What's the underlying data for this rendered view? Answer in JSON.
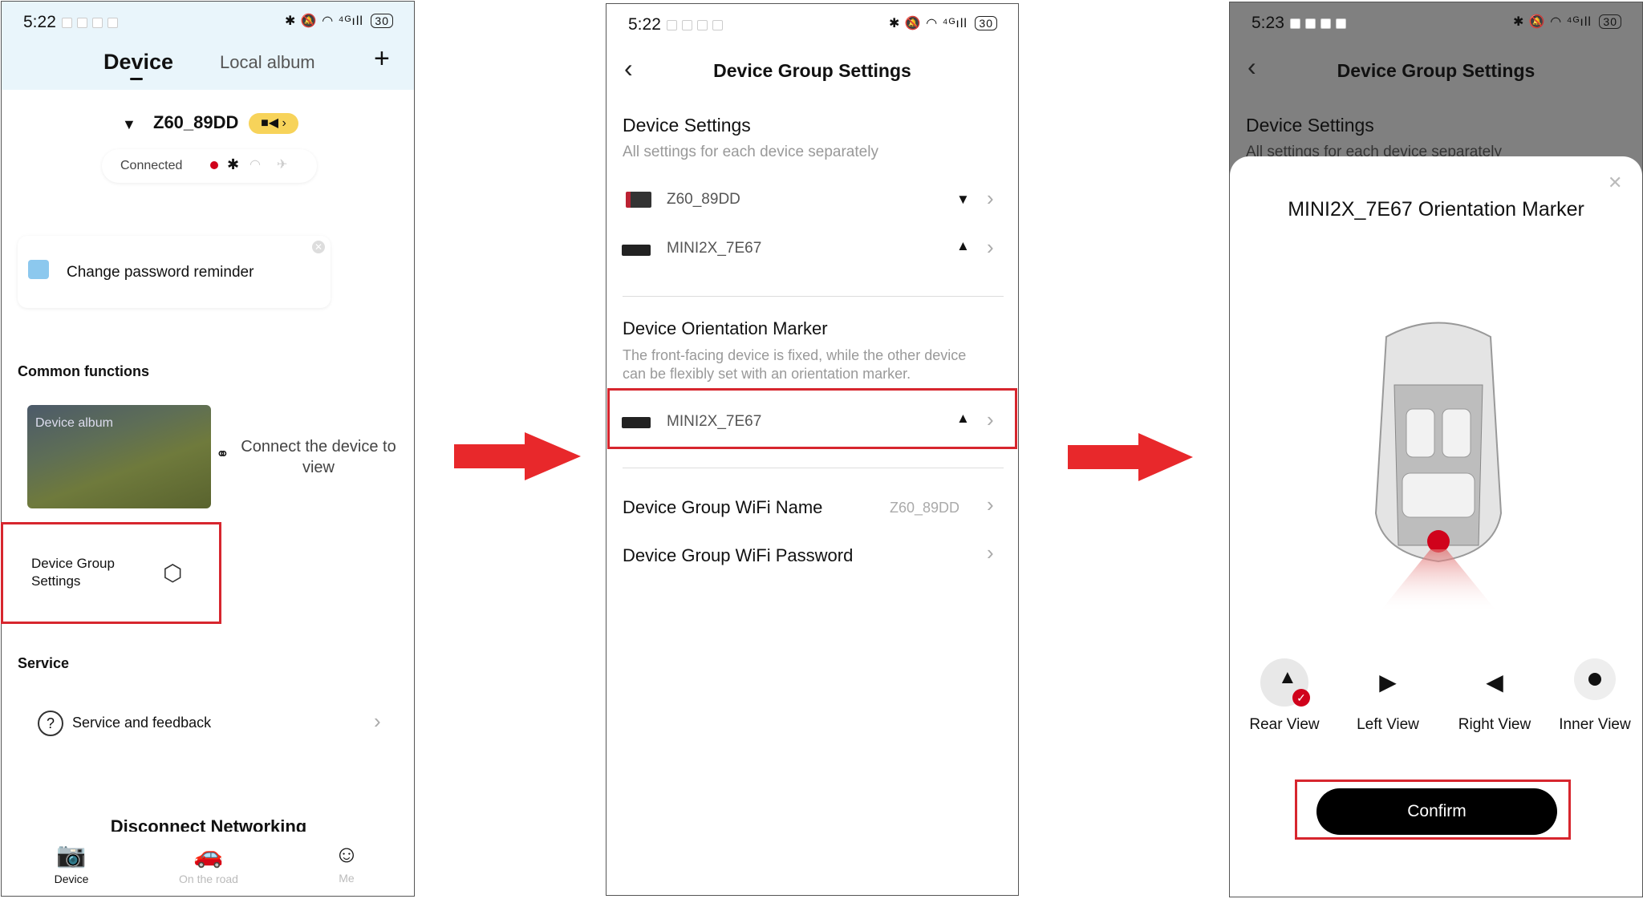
{
  "screen1": {
    "time": "5:22",
    "battery": "30",
    "tabs": {
      "device": "Device",
      "album": "Local album",
      "add": "+"
    },
    "device_name": "Z60_89DD",
    "connection_status": "Connected",
    "reminder": "Change password reminder",
    "common_functions_title": "Common functions",
    "device_album_label": "Device album",
    "connect_text": "Connect the device to view",
    "group_settings_label": "Device Group Settings",
    "service_title": "Service",
    "service_feedback": "Service and feedback",
    "disconnect": "Disconnect Networking",
    "nav": {
      "device": "Device",
      "road": "On the road",
      "me": "Me"
    }
  },
  "screen2": {
    "time": "5:22",
    "battery": "30",
    "title": "Device Group Settings",
    "device_settings_title": "Device Settings",
    "device_settings_sub": "All settings for each device separately",
    "devices": [
      {
        "name": "Z60_89DD"
      },
      {
        "name": "MINI2X_7E67"
      }
    ],
    "orientation_title": "Device Orientation Marker",
    "orientation_sub_1": "The front-facing device is fixed, while the other device",
    "orientation_sub_2": "can be flexibly set with an orientation marker.",
    "orientation_device": "MINI2X_7E67",
    "wifi_name_label": "Device Group WiFi Name",
    "wifi_name_value": "Z60_89DD",
    "wifi_password_label": "Device Group WiFi Password"
  },
  "screen3": {
    "time": "5:23",
    "battery": "30",
    "title": "Device Group Settings",
    "bg_section": "Device Settings",
    "bg_sub": "All settings for each device separately",
    "sheet_title": "MINI2X_7E67 Orientation Marker",
    "views": [
      {
        "label": "Rear View",
        "selected": true
      },
      {
        "label": "Left View",
        "selected": false
      },
      {
        "label": "Right View",
        "selected": false
      },
      {
        "label": "Inner View",
        "selected": false
      }
    ],
    "confirm": "Confirm"
  },
  "colors": {
    "highlight": "#d7262e",
    "arrow": "#e8282b",
    "accent_yellow": "#f7d35a",
    "rec_red": "#d0021b"
  }
}
